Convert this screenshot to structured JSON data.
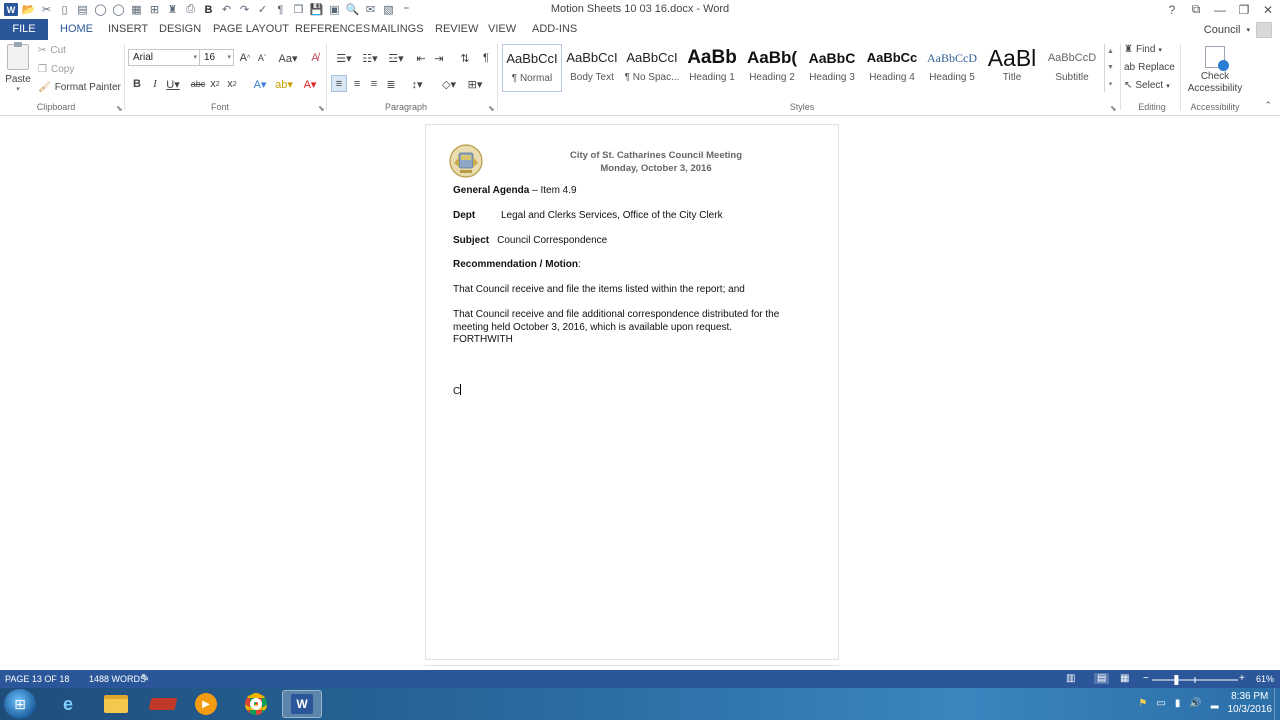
{
  "window": {
    "title": "Motion Sheets 10 03 16.docx - Word",
    "controls": [
      "?",
      "⧉",
      "—",
      "❐",
      "✕"
    ]
  },
  "quick_access": [
    "word-logo",
    "open",
    "tools",
    "new",
    "paste",
    "circle",
    "circle",
    "table",
    "borders",
    "binoculars",
    "print",
    "bold",
    "undo",
    "redo",
    "check",
    "pilcrow",
    "copy",
    "save",
    "save-as",
    "preview",
    "email",
    "pdf",
    "more"
  ],
  "tabs": {
    "file": "FILE",
    "home": "HOME",
    "insert": "INSERT",
    "design": "DESIGN",
    "page_layout": "PAGE LAYOUT",
    "references": "REFERENCES",
    "mailings": "MAILINGS",
    "review": "REVIEW",
    "view": "VIEW",
    "add_ins": "ADD-INS"
  },
  "account": {
    "name": "Council"
  },
  "ribbon": {
    "clipboard": {
      "paste": "Paste",
      "cut": "Cut",
      "copy": "Copy",
      "format_painter": "Format Painter",
      "label": "Clipboard"
    },
    "font": {
      "name": "Arial",
      "size": "16",
      "label": "Font"
    },
    "paragraph": {
      "label": "Paragraph"
    },
    "styles": {
      "label": "Styles",
      "items": [
        {
          "sample": "AaBbCcI",
          "name": "¶ Normal"
        },
        {
          "sample": "AaBbCcI",
          "name": "Body Text"
        },
        {
          "sample": "AaBbCcI",
          "name": "¶ No Spac..."
        },
        {
          "sample": "AaBb",
          "name": "Heading 1"
        },
        {
          "sample": "AaBb(",
          "name": "Heading 2"
        },
        {
          "sample": "AaBbC",
          "name": "Heading 3"
        },
        {
          "sample": "AaBbCc",
          "name": "Heading 4"
        },
        {
          "sample": "AaBbCcD",
          "name": "Heading 5"
        },
        {
          "sample": "AaBl",
          "name": "Title"
        },
        {
          "sample": "AaBbCcD",
          "name": "Subtitle"
        }
      ]
    },
    "editing": {
      "find": "Find",
      "replace": "Replace",
      "select": "Select",
      "label": "Editing"
    },
    "accessibility": {
      "button": "Check Accessibility",
      "label": "Accessibility"
    }
  },
  "document": {
    "header_line1": "City of St. Catharines Council Meeting",
    "header_line2": "Monday, October 3, 2016",
    "agenda_label": "General Agenda",
    "agenda_value": " – Item 4.9",
    "dept_label": "Dept",
    "dept_value": "Legal and Clerks Services, Office of the City Clerk",
    "subject_label": "Subject",
    "subject_value": "Council Correspondence",
    "recommendation_label": "Recommendation / Motion",
    "recommendation_colon": ":",
    "para1": "That Council receive and file the items listed within the report; and",
    "para2_line1": "That Council receive and file additional correspondence distributed for the",
    "para2_line2": "meeting held October 3, 2016, which is available upon request.",
    "para2_line3": "FORTHWITH",
    "typed": "C"
  },
  "statusbar": {
    "page": "PAGE 13 OF 18",
    "words": "1488 WORDS",
    "zoom": "61%",
    "zoom_level": 0.61
  },
  "taskbar": {
    "apps": [
      "internet-explorer",
      "file-explorer",
      "stapler",
      "media-player",
      "chrome",
      "word"
    ],
    "time": "8:36 PM",
    "date": "10/3/2016"
  }
}
